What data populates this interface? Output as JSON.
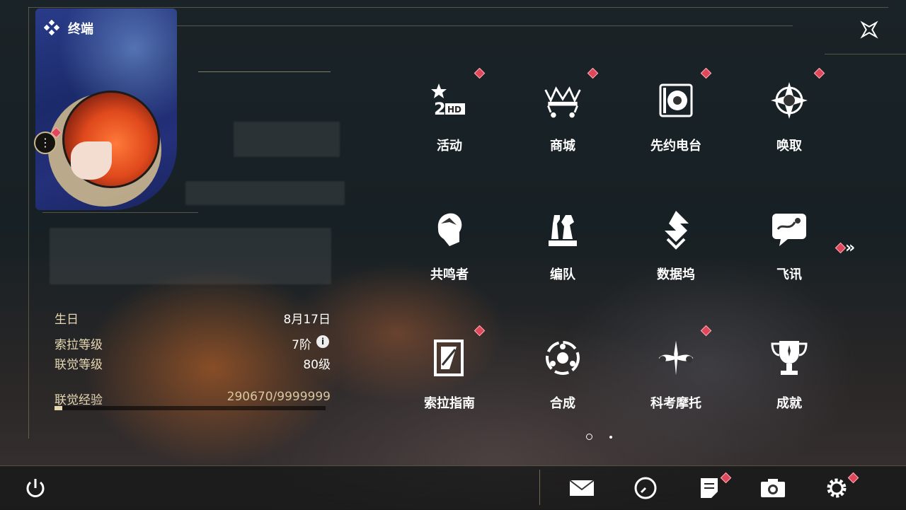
{
  "header": {
    "title": "终端"
  },
  "profile": {
    "stats": [
      {
        "label": "生日",
        "value": "8月17日"
      },
      {
        "label": "索拉等级",
        "value": "7阶"
      },
      {
        "label": "联觉等级",
        "value": "80级"
      }
    ],
    "xp": {
      "label": "联觉经验",
      "value": "290670/9999999",
      "fraction": 0.029
    }
  },
  "menu": {
    "items": [
      {
        "label": "活动",
        "icon": "event-2hd-icon",
        "badge": true
      },
      {
        "label": "商城",
        "icon": "shop-crown-cart-icon",
        "badge": true
      },
      {
        "label": "先约电台",
        "icon": "radio-icon",
        "badge": true
      },
      {
        "label": "唤取",
        "icon": "convene-compass-icon",
        "badge": true
      },
      {
        "label": "共鸣者",
        "icon": "resonator-head-icon",
        "badge": false
      },
      {
        "label": "编队",
        "icon": "team-chess-icon",
        "badge": false
      },
      {
        "label": "数据坞",
        "icon": "data-dock-icon",
        "badge": false
      },
      {
        "label": "飞讯",
        "icon": "message-chat-icon",
        "badge": false
      },
      {
        "label": "索拉指南",
        "icon": "guidebook-icon",
        "badge": true
      },
      {
        "label": "合成",
        "icon": "synthesis-icon",
        "badge": false
      },
      {
        "label": "科考摩托",
        "icon": "motorbike-icon",
        "badge": true
      },
      {
        "label": "成就",
        "icon": "trophy-icon",
        "badge": false
      }
    ],
    "page": {
      "current": 1,
      "total": 2
    }
  },
  "bottom_bar": {
    "icons": [
      "power-icon",
      "mail-icon",
      "clock-icon",
      "notes-icon",
      "camera-icon",
      "settings-gear-icon"
    ]
  },
  "colors": {
    "accent_gold": "#c9b78b",
    "badge_red": "#e0475a",
    "text_white": "#ffffff"
  }
}
